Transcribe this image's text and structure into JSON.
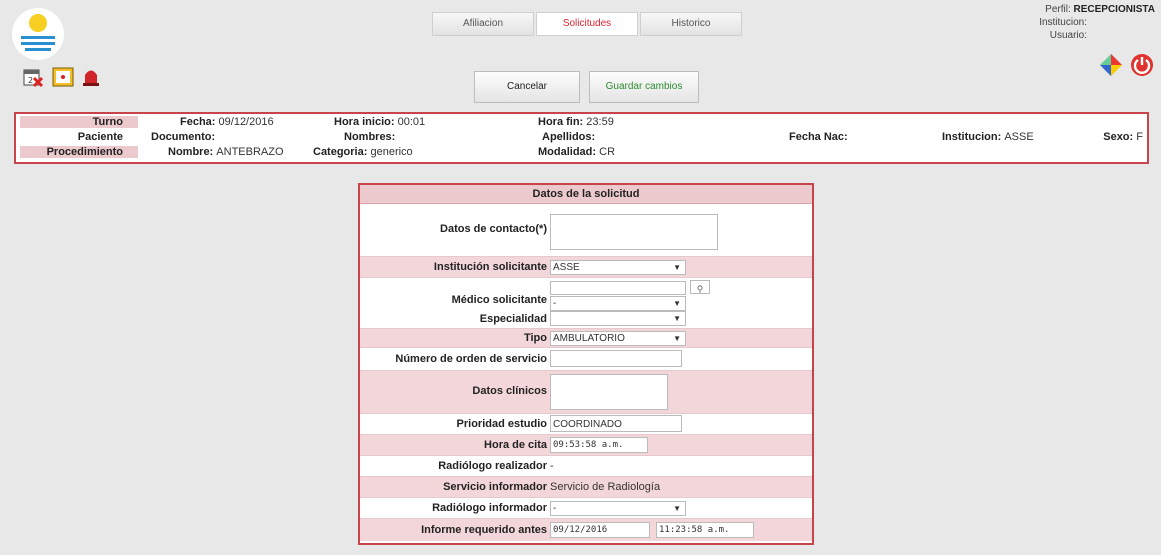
{
  "header": {
    "tabs": [
      {
        "label": "Afiliacion",
        "active": false
      },
      {
        "label": "Solicitudes",
        "active": true
      },
      {
        "label": "Historico",
        "active": false
      }
    ],
    "cancel_label": "Cancelar",
    "save_label": "Guardar cambios",
    "profile": {
      "perfil_label": "Perfil:",
      "perfil_value": "RECEPCIONISTA",
      "institucion_label": "Institucion:",
      "usuario_label": "Usuario:"
    },
    "icons": [
      "calendar-icon",
      "clock-icon",
      "alarm-icon",
      "puzzle-icon",
      "power-icon"
    ]
  },
  "info": {
    "turno": "Turno",
    "paciente": "Paciente",
    "procedimiento": "Procedimiento",
    "fecha_label": "Fecha:",
    "fecha_value": "09/12/2016",
    "hora_inicio_label": "Hora inicio:",
    "hora_inicio_value": "00:01",
    "hora_fin_label": "Hora fin:",
    "hora_fin_value": "23:59",
    "documento_label": "Documento:",
    "nombres_label": "Nombres:",
    "apellidos_label": "Apellidos:",
    "fecha_nac_label": "Fecha Nac:",
    "institucion_label": "Institucion:",
    "institucion_value": "ASSE",
    "sexo_label": "Sexo:",
    "sexo_value": "F",
    "nombre_label": "Nombre:",
    "nombre_value": "ANTEBRAZO",
    "categoria_label": "Categoria:",
    "categoria_value": "generico",
    "modalidad_label": "Modalidad:",
    "modalidad_value": "CR"
  },
  "form": {
    "title": "Datos de la solicitud",
    "contacto_label": "Datos de contacto(*)",
    "institucion_label": "Institución solicitante",
    "institucion_value": "ASSE",
    "medico_label": "Médico solicitante",
    "medico_select_value": "-",
    "especialidad_label": "Especialidad",
    "tipo_label": "Tipo",
    "tipo_value": "AMBULATORIO",
    "orden_label": "Número de orden de servicio",
    "clinicos_label": "Datos clínicos",
    "prioridad_label": "Prioridad estudio",
    "prioridad_value": "COORDINADO",
    "hora_cita_label": "Hora de cita",
    "hora_cita_value": "09:53:58 a.m.",
    "radiologo_realizador_label": "Radiólogo realizador",
    "radiologo_realizador_value": "-",
    "servicio_label": "Servicio informador",
    "servicio_value": "Servicio de Radiología",
    "radiologo_informador_label": "Radiólogo informador",
    "radiologo_informador_value": "-",
    "informe_label": "Informe requerido antes",
    "informe_fecha": "09/12/2016",
    "informe_hora": "11:23:58 a.m."
  }
}
